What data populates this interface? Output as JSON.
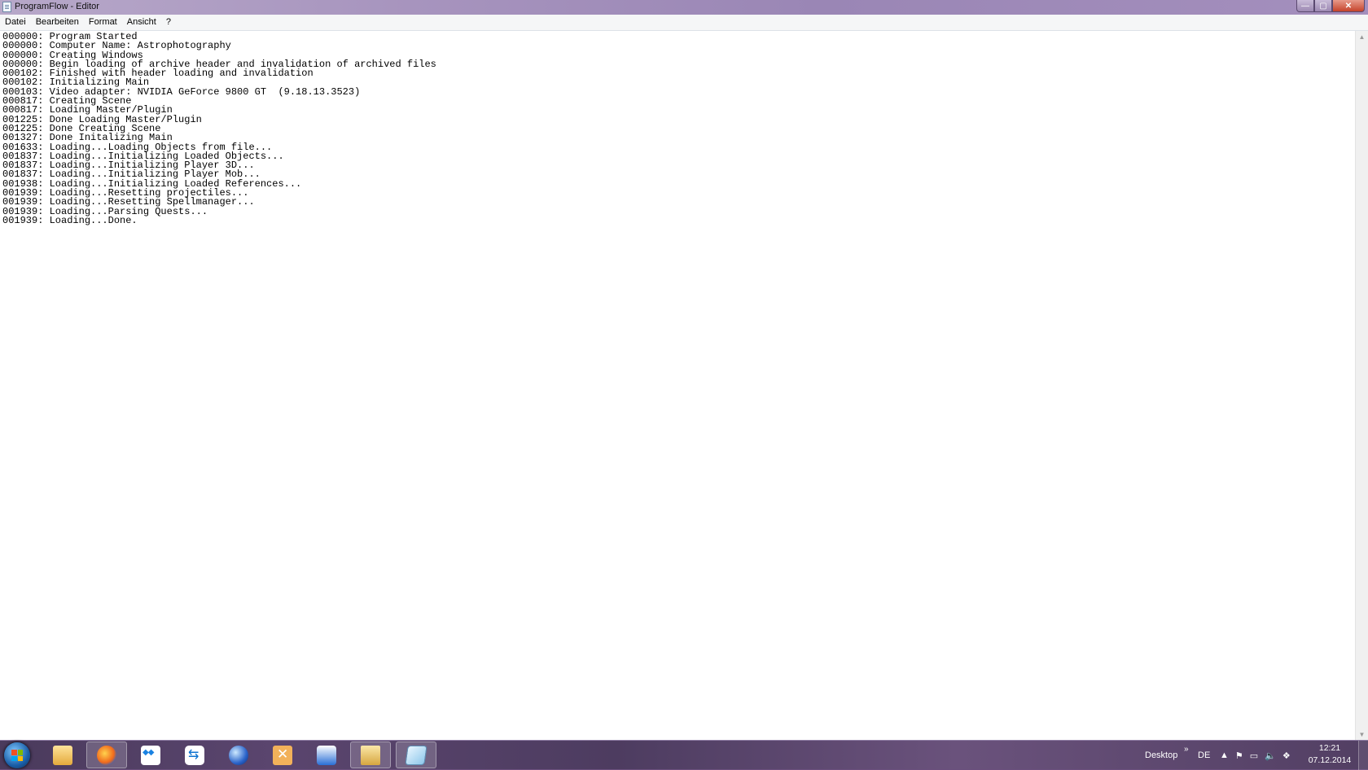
{
  "window": {
    "title": "ProgramFlow - Editor",
    "controls": {
      "minimize": "—",
      "maximize": "▢",
      "close": "✕"
    }
  },
  "menu": {
    "items": [
      "Datei",
      "Bearbeiten",
      "Format",
      "Ansicht",
      "?"
    ]
  },
  "editor": {
    "lines": [
      "000000: Program Started",
      "000000: Computer Name: Astrophotography",
      "000000: Creating Windows",
      "000000: Begin loading of archive header and invalidation of archived files",
      "000102: Finished with header loading and invalidation",
      "000102: Initializing Main",
      "000103: Video adapter: NVIDIA GeForce 9800 GT  (9.18.13.3523)",
      "000817: Creating Scene",
      "000817: Loading Master/Plugin",
      "001225: Done Loading Master/Plugin",
      "001225: Done Creating Scene",
      "001327: Done Initalizing Main",
      "001633: Loading...Loading Objects from file...",
      "001837: Loading...Initializing Loaded Objects...",
      "001837: Loading...Initializing Player 3D...",
      "001837: Loading...Initializing Player Mob...",
      "001938: Loading...Initializing Loaded References...",
      "001939: Loading...Resetting projectiles...",
      "001939: Loading...Resetting Spellmanager...",
      "001939: Loading...Parsing Quests...",
      "001939: Loading...Done."
    ]
  },
  "scrollbar": {
    "up": "▲",
    "down": "▼"
  },
  "taskbar": {
    "apps": [
      {
        "name": "explorer-icon",
        "active": false
      },
      {
        "name": "firefox-icon",
        "active": true
      },
      {
        "name": "dropbox-icon",
        "active": false
      },
      {
        "name": "teamviewer-icon",
        "active": false
      },
      {
        "name": "google-earth-icon",
        "active": false
      },
      {
        "name": "x-app-icon",
        "active": false
      },
      {
        "name": "blue-app-icon",
        "active": false
      },
      {
        "name": "folder-icon",
        "active": true
      },
      {
        "name": "notepad-icon",
        "active": true
      }
    ],
    "desktop_label": "Desktop",
    "chevron": "»",
    "language": "DE",
    "tray_arrow": "▲",
    "time": "12:21",
    "date": "07.12.2014"
  }
}
